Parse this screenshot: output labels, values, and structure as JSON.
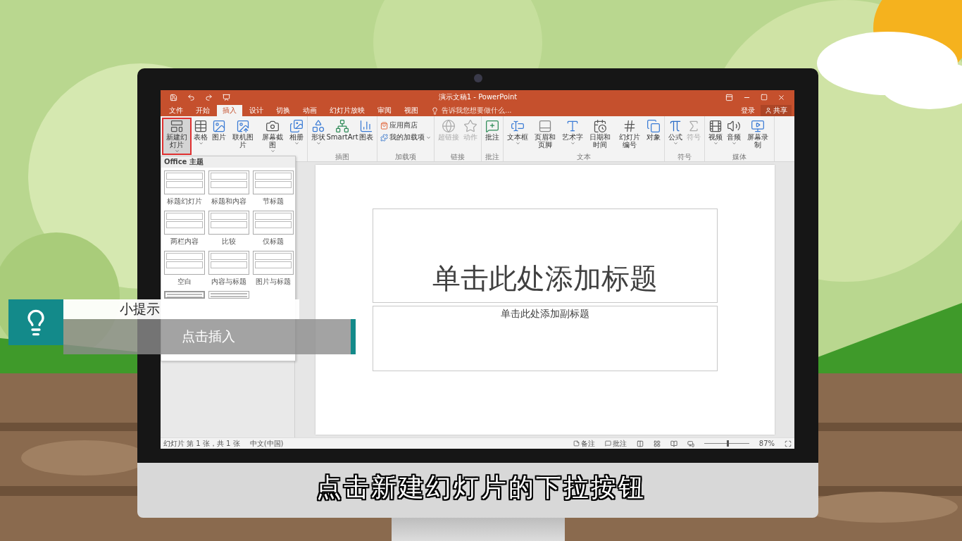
{
  "window": {
    "title": "演示文稿1 - PowerPoint"
  },
  "tabs": [
    {
      "label": "文件",
      "selected": false
    },
    {
      "label": "开始",
      "selected": false
    },
    {
      "label": "插入",
      "selected": true
    },
    {
      "label": "设计",
      "selected": false
    },
    {
      "label": "切换",
      "selected": false
    },
    {
      "label": "动画",
      "selected": false
    },
    {
      "label": "幻灯片放映",
      "selected": false
    },
    {
      "label": "审阅",
      "selected": false
    },
    {
      "label": "视图",
      "selected": false
    }
  ],
  "tell_me": {
    "placeholder": "告诉我您想要做什么..."
  },
  "account": {
    "sign_in": "登录",
    "share": "共享"
  },
  "ribbon_groups": [
    {
      "items": [
        {
          "label": "新建幻灯片",
          "kind": "large",
          "dropdown": true,
          "disabled": false,
          "highlighted": true
        },
        {
          "label": "表格",
          "kind": "large",
          "dropdown": true,
          "disabled": false,
          "highlighted": false
        },
        {
          "label": "图片",
          "kind": "large",
          "dropdown": false,
          "disabled": false,
          "highlighted": false
        },
        {
          "label": "联机图片",
          "kind": "large",
          "dropdown": false,
          "disabled": false,
          "highlighted": false
        },
        {
          "label": "屏幕截图",
          "kind": "large",
          "dropdown": true,
          "disabled": false,
          "highlighted": false
        },
        {
          "label": "相册",
          "kind": "large",
          "dropdown": true,
          "disabled": false,
          "highlighted": false
        }
      ]
    },
    {
      "label": "插图",
      "items": [
        {
          "label": "形状",
          "kind": "large",
          "dropdown": true,
          "disabled": false,
          "highlighted": false
        },
        {
          "label": "SmartArt",
          "kind": "large",
          "dropdown": false,
          "disabled": false,
          "highlighted": false
        },
        {
          "label": "图表",
          "kind": "large",
          "dropdown": false,
          "disabled": false,
          "highlighted": false
        }
      ]
    },
    {
      "label": "加载项",
      "items": [
        {
          "label": "应用商店",
          "kind": "small",
          "dropdown": false,
          "disabled": false,
          "highlighted": false
        },
        {
          "label": "我的加载项",
          "kind": "small",
          "dropdown": true,
          "disabled": false,
          "highlighted": false
        }
      ]
    },
    {
      "label": "链接",
      "items": [
        {
          "label": "超链接",
          "kind": "large",
          "dropdown": false,
          "disabled": true,
          "highlighted": false
        },
        {
          "label": "动作",
          "kind": "large",
          "dropdown": false,
          "disabled": true,
          "highlighted": false
        }
      ]
    },
    {
      "label": "批注",
      "items": [
        {
          "label": "批注",
          "kind": "large",
          "dropdown": false,
          "disabled": false,
          "highlighted": false
        }
      ]
    },
    {
      "label": "文本",
      "items": [
        {
          "label": "文本框",
          "kind": "large",
          "dropdown": true,
          "disabled": false,
          "highlighted": false
        },
        {
          "label": "页眉和页脚",
          "kind": "large",
          "dropdown": false,
          "disabled": false,
          "highlighted": false
        },
        {
          "label": "艺术字",
          "kind": "large",
          "dropdown": true,
          "disabled": false,
          "highlighted": false
        },
        {
          "label": "日期和时间",
          "kind": "large",
          "dropdown": false,
          "disabled": false,
          "highlighted": false
        },
        {
          "label": "幻灯片编号",
          "kind": "large",
          "dropdown": false,
          "disabled": false,
          "highlighted": false
        },
        {
          "label": "对象",
          "kind": "large",
          "dropdown": false,
          "disabled": false,
          "highlighted": false
        }
      ]
    },
    {
      "label": "符号",
      "items": [
        {
          "label": "公式",
          "kind": "large",
          "dropdown": true,
          "disabled": false,
          "highlighted": false
        },
        {
          "label": "符号",
          "kind": "large",
          "dropdown": false,
          "disabled": true,
          "highlighted": false
        }
      ]
    },
    {
      "label": "媒体",
      "items": [
        {
          "label": "视频",
          "kind": "large",
          "dropdown": true,
          "disabled": false,
          "highlighted": false
        },
        {
          "label": "音频",
          "kind": "large",
          "dropdown": true,
          "disabled": false,
          "highlighted": false
        },
        {
          "label": "屏幕录制",
          "kind": "large",
          "dropdown": false,
          "disabled": false,
          "highlighted": false
        }
      ]
    }
  ],
  "layout_menu": {
    "heading": "Office 主题",
    "layouts": [
      {
        "label": "标题幻灯片",
        "selected": false
      },
      {
        "label": "标题和内容",
        "selected": false
      },
      {
        "label": "节标题",
        "selected": false
      },
      {
        "label": "两栏内容",
        "selected": false
      },
      {
        "label": "比较",
        "selected": false
      },
      {
        "label": "仅标题",
        "selected": false
      },
      {
        "label": "空白",
        "selected": false
      },
      {
        "label": "内容与标题",
        "selected": false
      },
      {
        "label": "图片与标题",
        "selected": false
      },
      {
        "selected": true
      },
      {
        "selected": false
      }
    ]
  },
  "slide": {
    "title_placeholder": "单击此处添加标题",
    "subtitle_placeholder": "单击此处添加副标题"
  },
  "status_bar": {
    "slide_info": "幻灯片 第 1 张，共 1 张",
    "language": "中文(中国)",
    "notes": "备注",
    "comments": "批注",
    "zoom": {
      "level": 0.5,
      "reading": "87%"
    }
  },
  "tip": {
    "heading": "小提示",
    "text": "点击插入"
  },
  "subtitle": "点击新建幻灯片的下拉按钮"
}
